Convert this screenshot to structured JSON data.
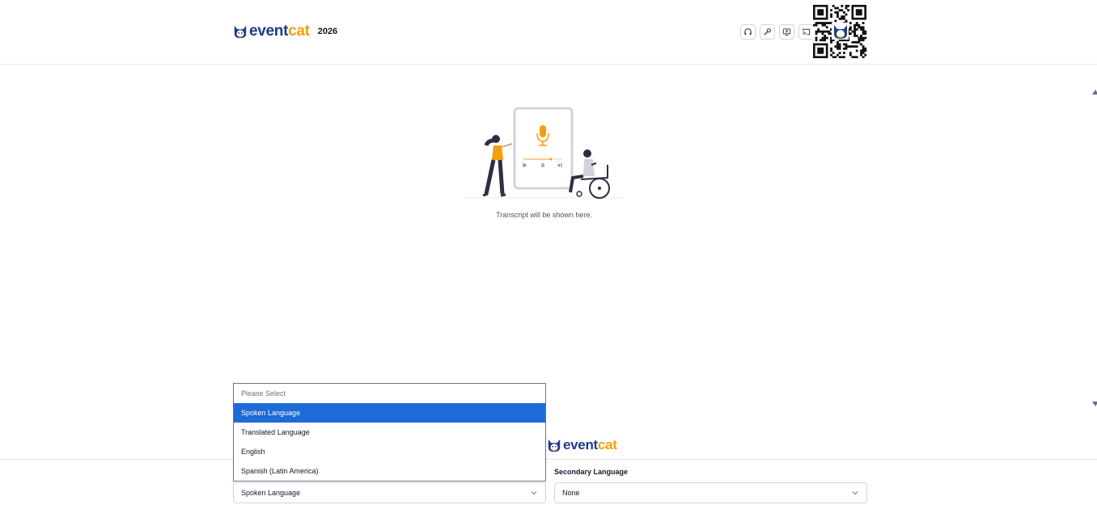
{
  "header": {
    "brand_event": "event",
    "brand_cat": "cat",
    "year": "2026",
    "icons": [
      "headphones-icon",
      "wrench-icon",
      "screen-share-icon",
      "cast-icon"
    ]
  },
  "main": {
    "transcript_hint": "Transcript will be shown here."
  },
  "footer": {
    "brand_event": "event",
    "brand_cat": "cat"
  },
  "controls": {
    "primary_select": {
      "value": "Spoken Language",
      "options": [
        "Please Select",
        "Spoken Language",
        "Translated Language",
        "English",
        "Spanish (Latin America)"
      ],
      "selected_index": 1
    },
    "secondary_label": "Secondary Language",
    "secondary_select": {
      "value": "None"
    }
  },
  "colors": {
    "brand_blue": "#1e3a8a",
    "brand_orange": "#f59e0b",
    "selection_blue": "#1c6bd6"
  }
}
